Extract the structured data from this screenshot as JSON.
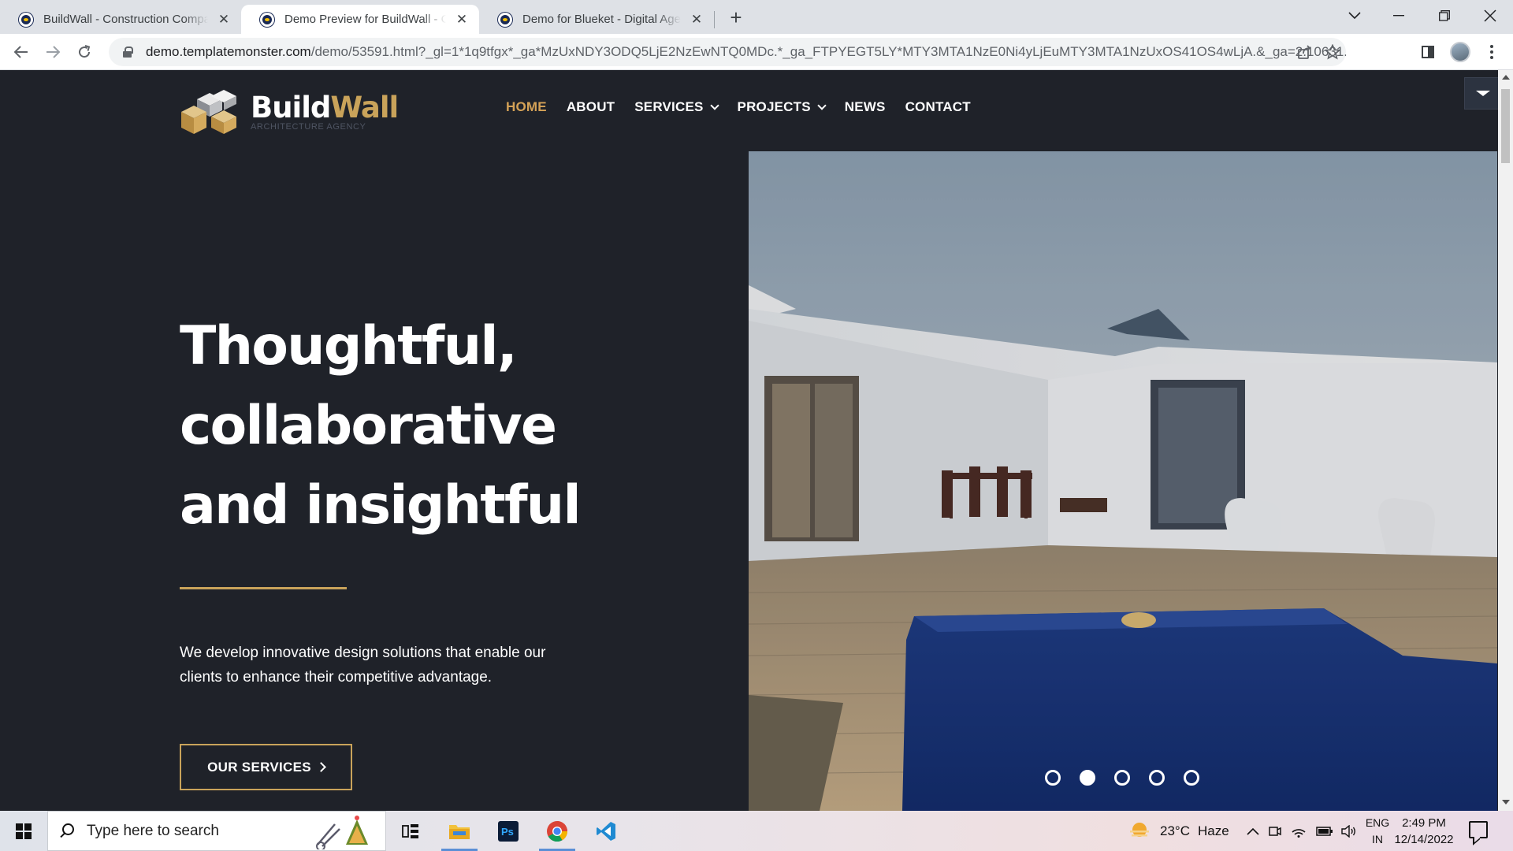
{
  "browser": {
    "tabs": [
      {
        "title": "BuildWall - Construction Company",
        "active": false
      },
      {
        "title": "Demo Preview for BuildWall - Construction",
        "active": true
      },
      {
        "title": "Demo for Blueket - Digital Agency",
        "active": false
      }
    ],
    "new_tab_label": "+",
    "address": {
      "host": "demo.templatemonster.com",
      "path": "/demo/53591.html?_gl=1*1q9tfgx*_ga*MzUxNDY3ODQ5LjE2NzEwNTQ0MDc.*_ga_FTPYEGT5LY*MTY3MTA1NzE0Ni4yLjEuMTY3MTA1NzUxOS41OS4wLjA.&_ga=2.10631..."
    }
  },
  "site": {
    "logo": {
      "word1": "Build",
      "word2": "Wall",
      "tagline": "ARCHITECTURE AGENCY"
    },
    "nav": [
      {
        "label": "HOME",
        "active": true,
        "has_dropdown": false
      },
      {
        "label": "ABOUT",
        "active": false,
        "has_dropdown": false
      },
      {
        "label": "SERVICES",
        "active": false,
        "has_dropdown": true
      },
      {
        "label": "PROJECTS",
        "active": false,
        "has_dropdown": true
      },
      {
        "label": "NEWS",
        "active": false,
        "has_dropdown": false
      },
      {
        "label": "CONTACT",
        "active": false,
        "has_dropdown": false
      }
    ],
    "hero": {
      "title_lines": [
        "Thoughtful,",
        "collaborative",
        "and insightful"
      ],
      "description": "We develop innovative design solutions that enable our clients to enhance their competitive advantage.",
      "cta_label": "OUR SERVICES",
      "slides_count": 5,
      "active_slide": 2
    }
  },
  "taskbar": {
    "search_placeholder": "Type here to search",
    "weather": {
      "temp": "23°C",
      "condition": "Haze"
    },
    "language": {
      "line1": "ENG",
      "line2": "IN"
    },
    "clock": {
      "time": "2:49 PM",
      "date": "12/14/2022"
    }
  },
  "colors": {
    "site_bg": "#1f2229",
    "accent_gold": "#c9a35a",
    "nav_active": "#d4a257",
    "pool_blue": "#1b3d8f"
  },
  "icons": [
    "favicon-icon",
    "close-icon",
    "back-arrow-icon",
    "forward-arrow-icon",
    "reload-icon",
    "lock-icon",
    "share-icon",
    "star-icon",
    "sidebar-icon",
    "kebab-menu-icon",
    "windows-logo-icon",
    "search-icon",
    "task-view-icon",
    "file-explorer-icon",
    "photoshop-icon",
    "chrome-icon",
    "vscode-icon",
    "weather-icon",
    "chevron-up-icon",
    "wifi-icon",
    "battery-icon",
    "volume-icon",
    "notification-icon"
  ]
}
